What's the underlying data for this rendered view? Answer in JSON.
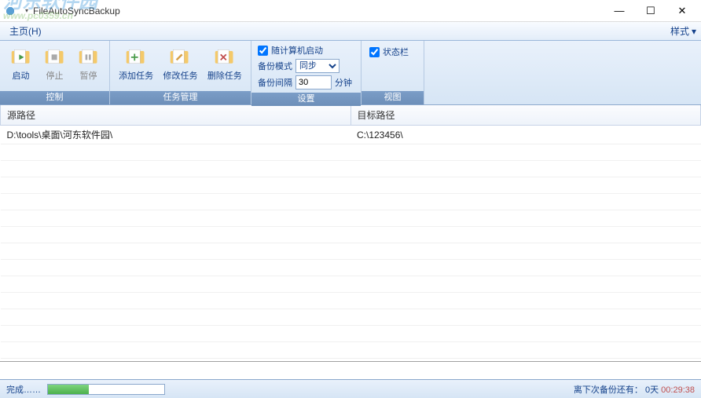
{
  "window": {
    "title": "FileAutoSyncBackup"
  },
  "watermark": {
    "text": "河东软件园",
    "url": "www.pc0359.cn"
  },
  "menubar": {
    "home": "主页(H)",
    "style": "样式",
    "style_arrow": "▾"
  },
  "ribbon": {
    "control": {
      "label": "控制",
      "start": "启动",
      "stop": "停止",
      "pause": "暂停"
    },
    "task": {
      "label": "任务管理",
      "add": "添加任务",
      "edit": "修改任务",
      "delete": "删除任务"
    },
    "settings": {
      "label": "设置",
      "autostart": "随计算机启动",
      "autostart_checked": true,
      "mode_label": "备份模式",
      "mode_value": "同步",
      "interval_label": "备份间隔",
      "interval_value": "30",
      "interval_unit": "分钟"
    },
    "view": {
      "label": "视图",
      "statusbar": "状态栏",
      "statusbar_checked": true
    }
  },
  "table": {
    "col_source": "源路径",
    "col_target": "目标路径",
    "rows": [
      {
        "source": "D:\\tools\\桌面\\河东软件园\\",
        "target": "C:\\123456\\"
      }
    ]
  },
  "statusbar": {
    "done": "完成……",
    "next_label": "离下次备份还有：",
    "days": "0天",
    "time": "00:29:38"
  }
}
